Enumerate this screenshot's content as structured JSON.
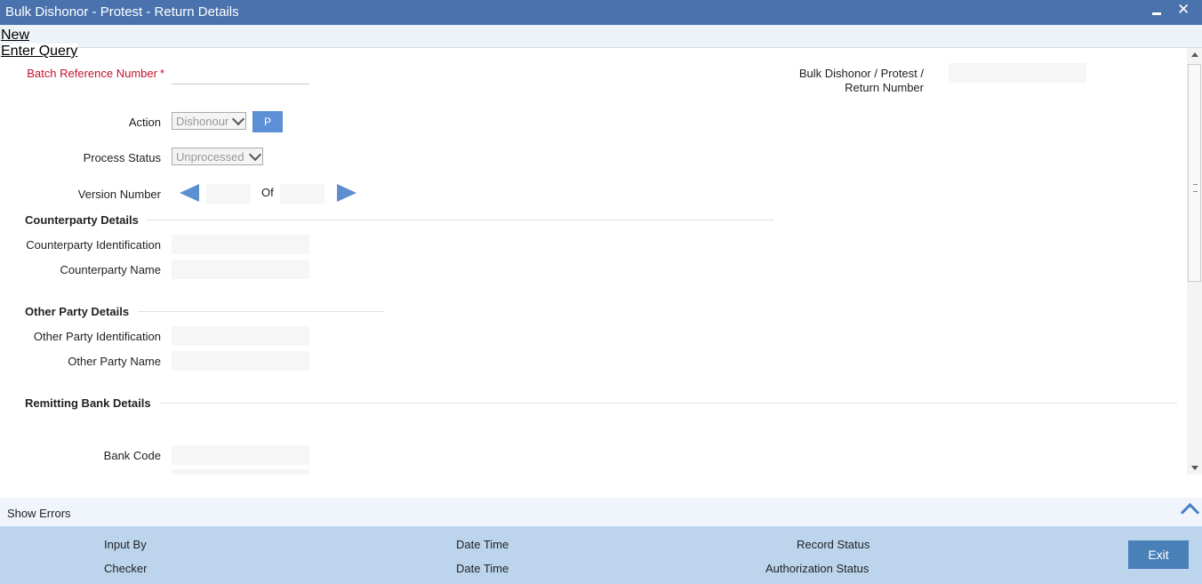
{
  "window": {
    "title": "Bulk Dishonor - Protest - Return Details"
  },
  "menu": {
    "new": "New",
    "enter_query": "Enter Query"
  },
  "form": {
    "batch_ref_label": "Batch Reference Number",
    "required_mark": "*",
    "bulk_number_label_1": "Bulk Dishonor / Protest /",
    "bulk_number_label_2": "Return Number",
    "action_label": "Action",
    "action_value": "Dishonour",
    "p_button": "P",
    "process_status_label": "Process Status",
    "process_status_value": "Unprocessed",
    "version_label": "Version Number",
    "of_label": "Of"
  },
  "sections": {
    "counterparty": "Counterparty Details",
    "counterparty_id_label": "Counterparty Identification",
    "counterparty_name_label": "Counterparty Name",
    "other_party": "Other Party Details",
    "other_party_id_label": "Other Party Identification",
    "other_party_name_label": "Other Party Name",
    "remitting_bank": "Remitting Bank Details",
    "bank_code_label": "Bank Code"
  },
  "errors": {
    "show_errors": "Show Errors"
  },
  "footer": {
    "input_by": "Input By",
    "checker": "Checker",
    "date_time_1": "Date Time",
    "date_time_2": "Date Time",
    "record_status": "Record Status",
    "authorization_status": "Authorization Status",
    "exit": "Exit"
  },
  "colors": {
    "titlebar": "#4a72ad",
    "accent": "#5c8fd6",
    "footer": "#bcd5ec",
    "required": "#c4122f"
  }
}
